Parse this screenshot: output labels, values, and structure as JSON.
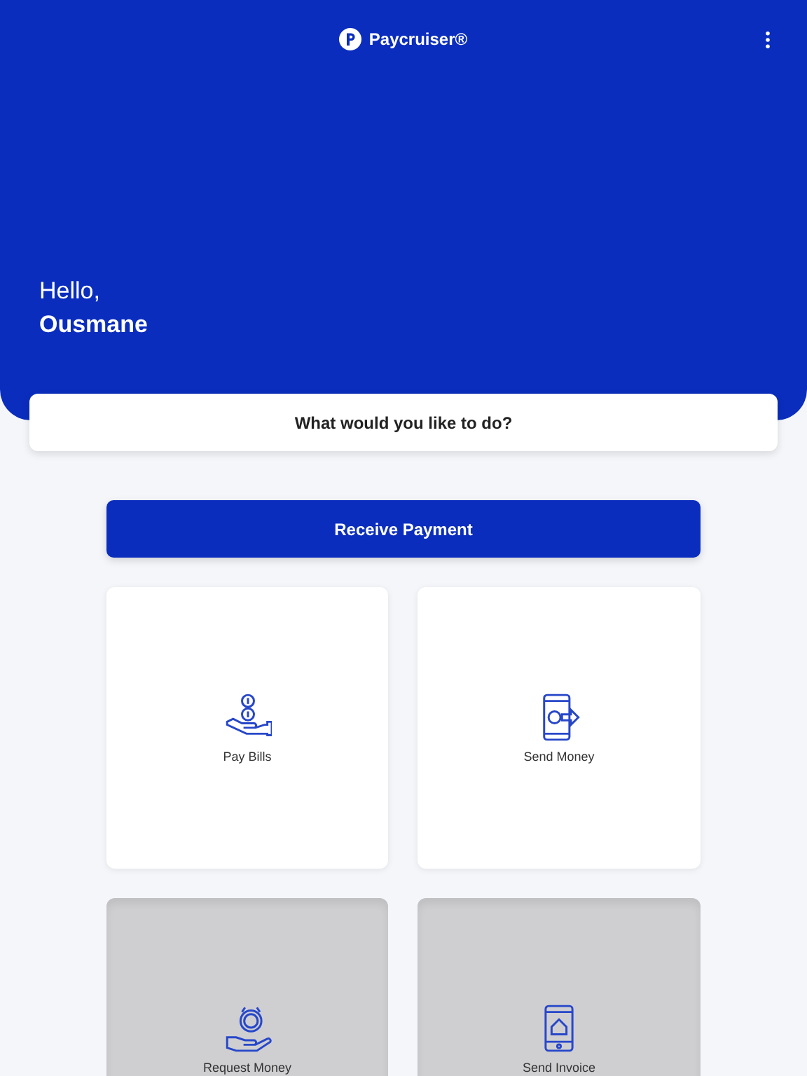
{
  "header": {
    "brand": "Paycruiser®",
    "greeting": "Hello,",
    "user_name": "Ousmane"
  },
  "prompt": "What would you like to do?",
  "primary_button": "Receive Payment",
  "actions": [
    {
      "label": "Pay Bills",
      "kind": "bills",
      "disabled": false
    },
    {
      "label": "Send Money",
      "kind": "send",
      "disabled": false
    },
    {
      "label": "Request Money",
      "kind": "request",
      "disabled": true
    },
    {
      "label": "Send Invoice",
      "kind": "invoice",
      "disabled": true
    }
  ]
}
